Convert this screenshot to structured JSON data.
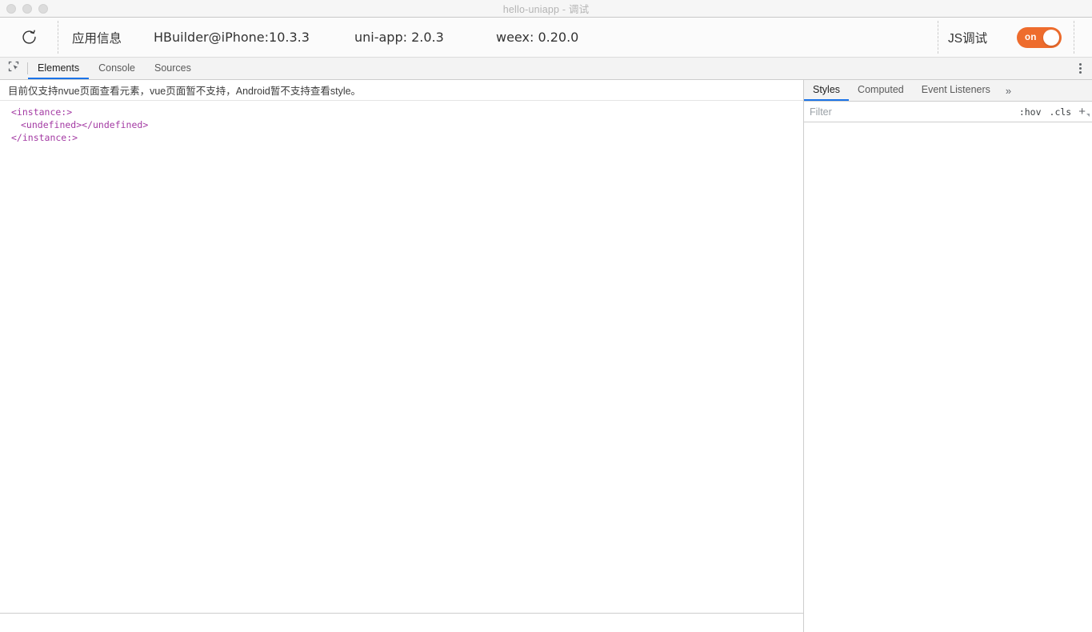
{
  "window": {
    "title": "hello-uniapp - 调试",
    "traffic_lights": [
      "close-button",
      "minimize-button",
      "zoom-button"
    ]
  },
  "app_toolbar": {
    "refresh_icon": "refresh-icon",
    "app_info_label": "应用信息",
    "device": "HBuilder@iPhone:10.3.3",
    "uniapp_version": "uni-app: 2.0.3",
    "weex_version": "weex: 0.20.0",
    "js_debug_label": "JS调试",
    "js_debug_toggle": {
      "state_text": "on",
      "enabled": true,
      "accent_color": "#ee6c2d"
    }
  },
  "devtools": {
    "inspect_icon": "inspect-element-icon",
    "tabs": [
      {
        "label": "Elements",
        "active": true
      },
      {
        "label": "Console",
        "active": false
      },
      {
        "label": "Sources",
        "active": false
      }
    ],
    "more_icon": "kebab-menu-icon",
    "active_tab_color": "#1a73e8"
  },
  "elements_panel": {
    "notice": "目前仅支持nvue页面查看元素，vue页面暂不支持，Android暂不支持查看style。",
    "dom_lines": [
      {
        "text": "<instance:>",
        "indent": 0
      },
      {
        "text": "<undefined></undefined>",
        "indent": 1
      },
      {
        "text": "</instance:>",
        "indent": 0
      }
    ],
    "dom_text_color": "#a33aa3"
  },
  "styles_panel": {
    "tabs": [
      {
        "label": "Styles",
        "active": true
      },
      {
        "label": "Computed",
        "active": false
      },
      {
        "label": "Event Listeners",
        "active": false
      }
    ],
    "more_tabs_icon": "chevron-double-right-icon",
    "filter_placeholder": "Filter",
    "filter_value": "",
    "hov_label": ":hov",
    "cls_label": ".cls",
    "new_rule_icon": "plus-icon"
  }
}
